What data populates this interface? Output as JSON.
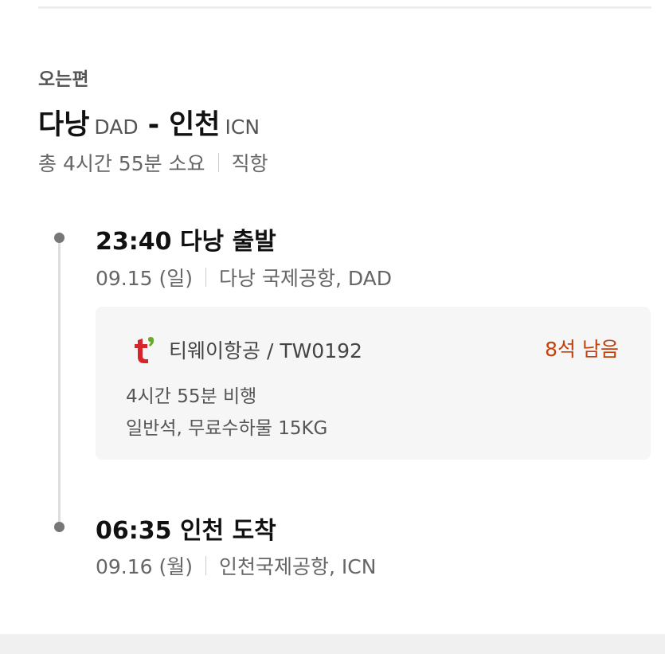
{
  "section_label": "오는편",
  "route": {
    "from_city": "다낭",
    "from_code": "DAD",
    "separator": "-",
    "to_city": "인천",
    "to_code": "ICN"
  },
  "summary": {
    "duration": "총 4시간 55분 소요",
    "type": "직항"
  },
  "departure": {
    "title": "23:40 다낭 출발",
    "date": "09.15 (일)",
    "airport": "다낭 국제공항, DAD"
  },
  "flight": {
    "airline": "티웨이항공 / TW0192",
    "seats_left": "8석 남음",
    "flight_time": "4시간 55분 비행",
    "fare_info": "일반석, 무료수하물 15KG",
    "logo_icon": "tway-airline-logo",
    "logo_color_t": "#d7262b",
    "logo_color_accent": "#6aaa2b"
  },
  "arrival": {
    "title": "06:35 인천 도착",
    "date": "09.16 (월)",
    "airport": "인천국제공항, ICN"
  },
  "colors": {
    "seats_accent": "#c2410c",
    "timeline": "#777777"
  }
}
